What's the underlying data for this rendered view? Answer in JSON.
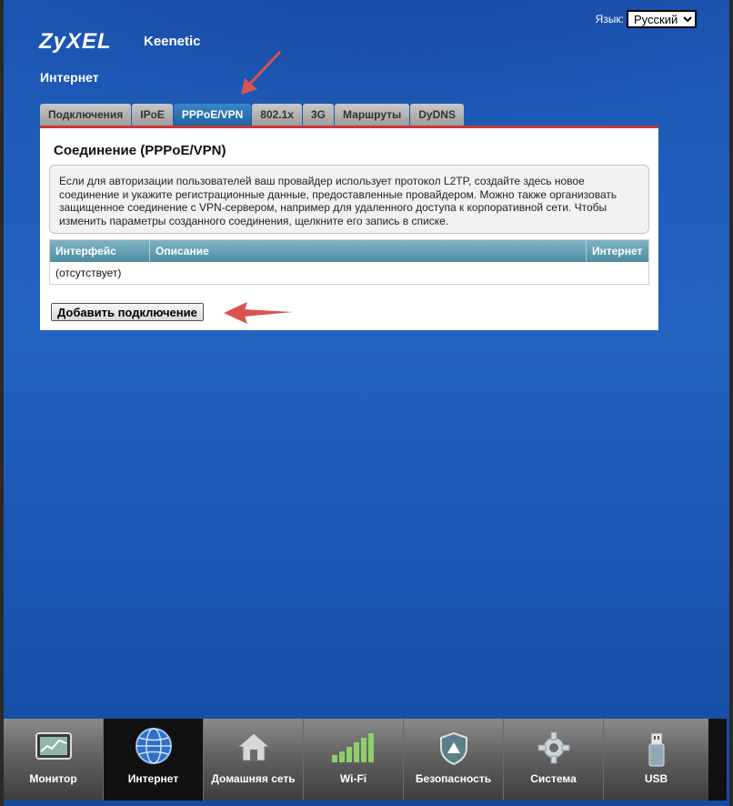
{
  "header": {
    "language_label": "Язык:",
    "language_value": "Русский",
    "brand": "ZyXEL",
    "product": "Keenetic",
    "section_title": "Интернет"
  },
  "tabs": [
    {
      "label": "Подключения",
      "active": false
    },
    {
      "label": "IPoE",
      "active": false
    },
    {
      "label": "PPPoE/VPN",
      "active": true
    },
    {
      "label": "802.1x",
      "active": false
    },
    {
      "label": "3G",
      "active": false
    },
    {
      "label": "Маршруты",
      "active": false
    },
    {
      "label": "DyDNS",
      "active": false
    }
  ],
  "panel": {
    "title": "Соединение (PPPoE/VPN)",
    "info_text": "Если для авторизации пользователей ваш провайдер использует протокол L2TP, создайте здесь новое соединение и укажите регистрационные данные, предоставленные провайдером. Можно также организовать защищенное соединение с VPN-сервером, например для удаленного доступа к корпоративной сети. Чтобы изменить параметры созданного соединения, щелкните его запись в списке.",
    "table": {
      "columns": [
        "Интерфейс",
        "Описание",
        "Интернет"
      ],
      "empty_text": "(отсутствует)"
    },
    "add_button": "Добавить подключение"
  },
  "bottom_nav": [
    {
      "label": "Монитор",
      "icon": "monitor-icon",
      "active": false
    },
    {
      "label": "Интернет",
      "icon": "globe-icon",
      "active": true
    },
    {
      "label": "Домашняя сеть",
      "icon": "home-icon",
      "active": false
    },
    {
      "label": "Wi-Fi",
      "icon": "wifi-signal-icon",
      "active": false
    },
    {
      "label": "Безопасность",
      "icon": "shield-icon",
      "active": false
    },
    {
      "label": "Система",
      "icon": "gear-icon",
      "active": false
    },
    {
      "label": "USB",
      "icon": "usb-icon",
      "active": false
    }
  ],
  "colors": {
    "background_blue": "#1d57b3",
    "active_tab": "#2a75b8",
    "tab_underline": "#c53a3a",
    "annotation_arrow": "#d9534f",
    "table_header": "#5f9db1"
  }
}
